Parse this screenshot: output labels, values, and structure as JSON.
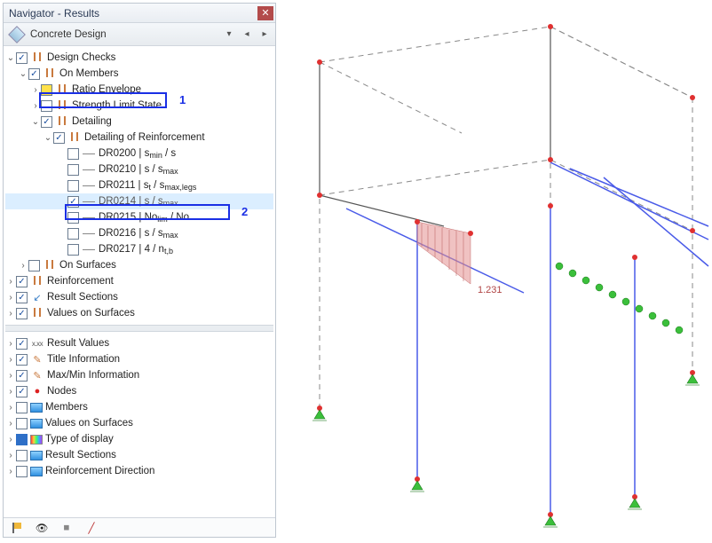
{
  "window": {
    "title": "Navigator - Results"
  },
  "dropdown": {
    "label": "Concrete Design"
  },
  "tree": {
    "designChecks": "Design Checks",
    "onMembers": "On Members",
    "ratioEnvelope": "Ratio Envelope",
    "strengthLimitState": "Strength Limit State",
    "detailing": "Detailing",
    "detailingOfReinforcement": "Detailing of Reinforcement",
    "dr0200": "DR0200 | s",
    "dr0200_sub": "min",
    "dr0200_tail": " / s",
    "dr0210": "DR0210 | s / s",
    "dr0210_sub": "max",
    "dr0211": "DR0211 | s",
    "dr0211_sub1": "t",
    "dr0211_mid": " / s",
    "dr0211_sub2": "max,legs",
    "dr0214": "DR0214 | s / s",
    "dr0214_sub": "max",
    "dr0215": "DR0215 | No",
    "dr0215_sub": "lim",
    "dr0215_tail": " / No",
    "dr0216": "DR0216 | s / s",
    "dr0216_sub": "max",
    "dr0217": "DR0217 | 4 / n",
    "dr0217_sub": "t,b",
    "onSurfaces": "On Surfaces",
    "reinforcement": "Reinforcement",
    "resultSections": "Result Sections",
    "valuesOnSurfaces": "Values on Surfaces"
  },
  "list": {
    "resultValues": "Result Values",
    "titleInfo": "Title Information",
    "maxMinInfo": "Max/Min Information",
    "nodes": "Nodes",
    "members": "Members",
    "valuesOnSurfaces": "Values on Surfaces",
    "typeOfDisplay": "Type of display",
    "resultSections": "Result Sections",
    "reinfDirection": "Reinforcement Direction"
  },
  "annotations": {
    "one": "1",
    "two": "2"
  },
  "viewport": {
    "valueLabel": "1.231"
  }
}
